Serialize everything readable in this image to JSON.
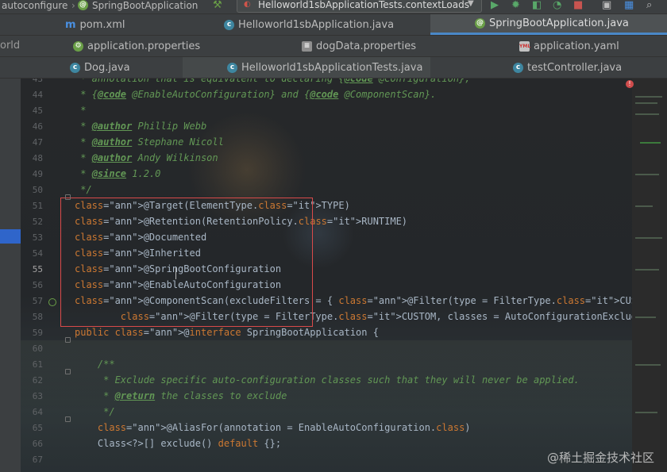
{
  "navbar": {
    "breadcrumb_left": "autoconfigure",
    "breadcrumb_right": "SpringBootApplication",
    "run_config": "Helloworld1sbApplicationTests.contextLoads"
  },
  "tabs_row1": [
    {
      "label": "pom.xml",
      "icon": "maven-icon",
      "active": false
    },
    {
      "label": "Helloworld1sbApplication.java",
      "icon": "class-icon",
      "active": false
    },
    {
      "label": "SpringBootApplication.java",
      "icon": "annotation-icon",
      "active": true
    }
  ],
  "tabs_row2": [
    {
      "label": "application.properties",
      "icon": "spring-properties-icon"
    },
    {
      "label": "dogData.properties",
      "icon": "properties-icon"
    },
    {
      "label": "application.yaml",
      "icon": "yaml-icon"
    }
  ],
  "tabs_row3": [
    {
      "label": "Dog.java",
      "icon": "class-icon"
    },
    {
      "label": "Helloworld1sbApplicationTests.java",
      "icon": "test-class-icon"
    },
    {
      "label": "testController.java",
      "icon": "class-icon"
    }
  ],
  "project_pane": {
    "partial_label": "orld"
  },
  "editor": {
    "current_line": 55,
    "lines": [
      {
        "n": "43",
        "text": " * annotation that is equivalent to declaring {@code @Configuration},"
      },
      {
        "n": "44",
        "text": " * {@code @EnableAutoConfiguration} and {@code @ComponentScan}."
      },
      {
        "n": "45",
        "text": " *"
      },
      {
        "n": "46",
        "text": " * @author Phillip Webb"
      },
      {
        "n": "47",
        "text": " * @author Stephane Nicoll"
      },
      {
        "n": "48",
        "text": " * @author Andy Wilkinson"
      },
      {
        "n": "49",
        "text": " * @since 1.2.0"
      },
      {
        "n": "50",
        "text": " */"
      },
      {
        "n": "51",
        "text": "@Target(ElementType.TYPE)"
      },
      {
        "n": "52",
        "text": "@Retention(RetentionPolicy.RUNTIME)"
      },
      {
        "n": "53",
        "text": "@Documented"
      },
      {
        "n": "54",
        "text": "@Inherited"
      },
      {
        "n": "55",
        "text": "@SpringBootConfiguration"
      },
      {
        "n": "56",
        "text": "@EnableAutoConfiguration"
      },
      {
        "n": "57",
        "text": "@ComponentScan(excludeFilters = { @Filter(type = FilterType.CUSTOM, classes = TypeExcludeFilter.clas"
      },
      {
        "n": "58",
        "text": "        @Filter(type = FilterType.CUSTOM, classes = AutoConfigurationExcludeFilter.class) })"
      },
      {
        "n": "59",
        "text": "public @interface SpringBootApplication {"
      },
      {
        "n": "60",
        "text": ""
      },
      {
        "n": "61",
        "text": "    /**"
      },
      {
        "n": "62",
        "text": "     * Exclude specific auto-configuration classes such that they will never be applied."
      },
      {
        "n": "63",
        "text": "     * @return the classes to exclude"
      },
      {
        "n": "64",
        "text": "     */"
      },
      {
        "n": "65",
        "text": "    @AliasFor(annotation = EnableAutoConfiguration.class)"
      },
      {
        "n": "66",
        "text": "    Class<?>[] exclude() default {};"
      },
      {
        "n": "67",
        "text": ""
      }
    ]
  },
  "inspection": {
    "error_marker": "!"
  },
  "watermark": "@稀土掘金技术社区",
  "colors": {
    "comment": "#629755",
    "annotation": "#bbb529",
    "keyword": "#cc7832",
    "constant": "#9876aa",
    "tab_accent": "#4a88c7",
    "highlight_box": "#d94a4a"
  }
}
